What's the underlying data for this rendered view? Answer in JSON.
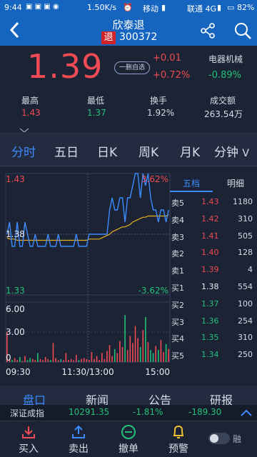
{
  "status": {
    "time": "9:44",
    "speed": "1.50K/s",
    "carrier1": "移动",
    "carrier2": "联通 4G",
    "battery": "82%"
  },
  "header": {
    "stock_name": "欣泰退",
    "badge": "退",
    "code": "300372"
  },
  "quote": {
    "price": "1.39",
    "change": "+0.01",
    "change_pct": "+0.72%",
    "delete_label": "一删自选",
    "sector": "电器机械",
    "sector_pct": "-0.89%",
    "stats": [
      {
        "label": "最高",
        "value": "1.43"
      },
      {
        "label": "最低",
        "value": "1.37"
      },
      {
        "label": "换手",
        "value": "1.92%"
      },
      {
        "label": "成交额",
        "value": "263.54万"
      }
    ]
  },
  "periods": [
    "分时",
    "五日",
    "日K",
    "周K",
    "月K",
    "分钟"
  ],
  "periods_more": "V",
  "chart_data": {
    "type": "line",
    "price_top_label": "1.43",
    "price_mid_label": "1.38",
    "price_bottom_label": "1.33",
    "pct_top_label": "3.62%",
    "pct_bottom_label": "-3.62%",
    "vol_top_label": "6.00",
    "vol_mid_label": "3.00",
    "vol_bottom_label": "0",
    "time_labels": [
      "09:30",
      "11:30/13:00",
      "15:00"
    ],
    "price_range": [
      1.33,
      1.43
    ],
    "prev_close": 1.38,
    "series": [
      {
        "values": [
          1.38,
          1.39,
          1.37,
          1.37,
          1.39,
          1.37,
          1.37,
          1.39,
          1.38,
          1.37,
          1.37,
          1.38,
          1.37,
          1.37,
          1.37,
          1.37,
          1.38,
          1.37,
          1.37,
          1.37,
          1.38,
          1.37,
          1.37,
          1.37,
          1.37,
          1.37,
          1.37,
          1.38,
          1.37,
          1.37,
          1.37,
          1.37,
          1.38,
          1.38,
          1.38,
          1.38,
          1.38,
          1.38,
          1.38,
          1.38,
          1.4,
          1.41,
          1.4,
          1.4,
          1.41,
          1.41,
          1.39,
          1.41,
          1.41,
          1.42,
          1.43,
          1.43,
          1.41,
          1.43,
          1.42,
          1.43,
          1.41,
          1.4,
          1.4,
          1.39,
          1.4,
          1.4,
          1.39,
          1.4
        ]
      },
      {
        "values": [
          1.377,
          1.376,
          1.376,
          1.376,
          1.375,
          1.375,
          1.375,
          1.375,
          1.375,
          1.375,
          1.375,
          1.375,
          1.375,
          1.375,
          1.375,
          1.375,
          1.375,
          1.375,
          1.375,
          1.375,
          1.375,
          1.375,
          1.375,
          1.375,
          1.375,
          1.375,
          1.375,
          1.375,
          1.375,
          1.375,
          1.375,
          1.375,
          1.376,
          1.376,
          1.376,
          1.376,
          1.376,
          1.377,
          1.378,
          1.379,
          1.38,
          1.382,
          1.383,
          1.384,
          1.385,
          1.386,
          1.386,
          1.387,
          1.388,
          1.39,
          1.391,
          1.392,
          1.393,
          1.394,
          1.394,
          1.395,
          1.395,
          1.395,
          1.395,
          1.395,
          1.395,
          1.395,
          1.395,
          1.396
        ]
      }
    ],
    "volumes": [
      3.0,
      0.3,
      0.2,
      0.4,
      0.2,
      0.5,
      0.1,
      0.6,
      0.2,
      0.4,
      0.3,
      0.2,
      0.9,
      0.3,
      0.2,
      0.5,
      0.3,
      0.2,
      1.9,
      0.4,
      0.2,
      0.3,
      0.2,
      0.9,
      0.2,
      0.3,
      0.2,
      0.7,
      0.2,
      0.3,
      0.4,
      0.3,
      0.2,
      1.0,
      0.3,
      0.6,
      0.2,
      0.9,
      0.3,
      1.1,
      1.7,
      0.6,
      1.3,
      0.9,
      2.1,
      1.5,
      4.7,
      1.2,
      2.6,
      1.9,
      3.6,
      2.4,
      1.5,
      3.2,
      4.5,
      2.0,
      1.2,
      0.9,
      1.6,
      1.2,
      2.2,
      1.0,
      1.8,
      1.3
    ]
  },
  "orderbook": {
    "tab_active": "五档",
    "tab_other": "明细",
    "rows": [
      {
        "label": "卖5",
        "price": "1.43",
        "vol": "1180",
        "color": "red"
      },
      {
        "label": "卖4",
        "price": "1.42",
        "vol": "310",
        "color": "red"
      },
      {
        "label": "卖3",
        "price": "1.41",
        "vol": "505",
        "color": "red"
      },
      {
        "label": "卖2",
        "price": "1.40",
        "vol": "128",
        "color": "red"
      },
      {
        "label": "卖1",
        "price": "1.39",
        "vol": "4",
        "color": "red"
      },
      {
        "label": "买1",
        "price": "1.38",
        "vol": "554",
        "color": "white"
      },
      {
        "label": "买2",
        "price": "1.37",
        "vol": "100",
        "color": "green"
      },
      {
        "label": "买3",
        "price": "1.36",
        "vol": "254",
        "color": "green"
      },
      {
        "label": "买4",
        "price": "1.35",
        "vol": "310",
        "color": "green"
      },
      {
        "label": "买5",
        "price": "1.34",
        "vol": "250",
        "color": "green"
      }
    ]
  },
  "bottom_tabs": [
    "盘口",
    "新闻",
    "公告",
    "研报"
  ],
  "index_bar": {
    "name": "深证成指",
    "value": "10291.35",
    "pct": "-1.81%",
    "change": "-189.30"
  },
  "nav": [
    {
      "label": "买入",
      "icon": "buy-icon",
      "color": "#f04b54"
    },
    {
      "label": "卖出",
      "icon": "sell-icon",
      "color": "#3d8bfd"
    },
    {
      "label": "撤单",
      "icon": "cancel-order-icon",
      "color": "#22c17a"
    },
    {
      "label": "预警",
      "icon": "alarm-bell-icon",
      "color": "#f2c12e"
    }
  ],
  "nav_toggle_label": "融",
  "colors": {
    "up": "#f04b54",
    "down": "#22c17a",
    "brand": "#1565c0",
    "price_line": "#3d8bfd",
    "avg_line": "#e8b020"
  }
}
